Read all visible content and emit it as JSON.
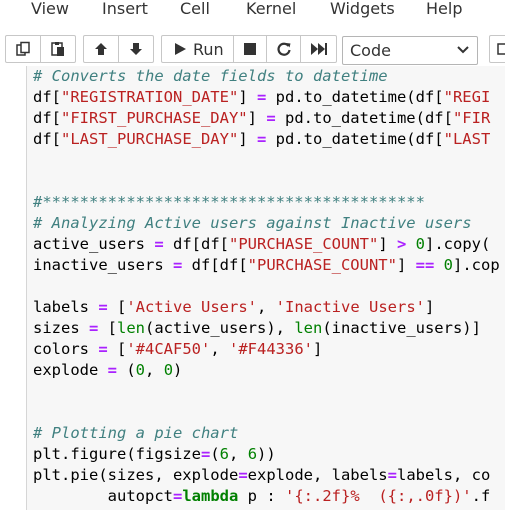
{
  "menu": {
    "items": [
      "View",
      "Insert",
      "Cell",
      "Kernel",
      "Widgets",
      "Help"
    ]
  },
  "toolbar": {
    "run_label": "Run",
    "cell_type": "Code",
    "buttons": [
      "copy-icon",
      "paste-icon",
      "move-up-icon",
      "move-down-icon",
      "run-icon",
      "stop-icon",
      "restart-icon",
      "fast-forward-icon",
      "command-palette-icon"
    ]
  },
  "colors": {
    "comment": "#408080",
    "string": "#BA2121",
    "operator": "#AA22FF",
    "keyword": "#008000",
    "number": "#008000"
  },
  "code": {
    "lines": [
      [
        [
          "cm",
          "# Converts the date fields to datetime"
        ]
      ],
      [
        [
          "t",
          "df["
        ],
        [
          "st",
          "\"REGISTRATION_DATE\""
        ],
        [
          "t",
          "] "
        ],
        [
          "op",
          "="
        ],
        [
          "t",
          " pd.to_datetime(df["
        ],
        [
          "st",
          "\"REGI"
        ]
      ],
      [
        [
          "t",
          "df["
        ],
        [
          "st",
          "\"FIRST_PURCHASE_DAY\""
        ],
        [
          "t",
          "] "
        ],
        [
          "op",
          "="
        ],
        [
          "t",
          " pd.to_datetime(df["
        ],
        [
          "st",
          "\"FIR"
        ]
      ],
      [
        [
          "t",
          "df["
        ],
        [
          "st",
          "\"LAST_PURCHASE_DAY\""
        ],
        [
          "t",
          "] "
        ],
        [
          "op",
          "="
        ],
        [
          "t",
          " pd.to_datetime(df["
        ],
        [
          "st",
          "\"LAST"
        ]
      ],
      [],
      [],
      [
        [
          "cm",
          "#*****************************************"
        ]
      ],
      [
        [
          "cm",
          "# Analyzing Active users against Inactive users"
        ]
      ],
      [
        [
          "t",
          "active_users "
        ],
        [
          "op",
          "="
        ],
        [
          "t",
          " df[df["
        ],
        [
          "st",
          "\"PURCHASE_COUNT\""
        ],
        [
          "t",
          "] "
        ],
        [
          "op",
          ">"
        ],
        [
          "t",
          " "
        ],
        [
          "nm",
          "0"
        ],
        [
          "t",
          "].copy("
        ]
      ],
      [
        [
          "t",
          "inactive_users "
        ],
        [
          "op",
          "="
        ],
        [
          "t",
          " df[df["
        ],
        [
          "st",
          "\"PURCHASE_COUNT\""
        ],
        [
          "t",
          "] "
        ],
        [
          "op",
          "=="
        ],
        [
          "t",
          " "
        ],
        [
          "nm",
          "0"
        ],
        [
          "t",
          "].cop"
        ]
      ],
      [],
      [
        [
          "t",
          "labels "
        ],
        [
          "op",
          "="
        ],
        [
          "t",
          " ["
        ],
        [
          "st",
          "'Active Users'"
        ],
        [
          "t",
          ", "
        ],
        [
          "st",
          "'Inactive Users'"
        ],
        [
          "t",
          "]"
        ]
      ],
      [
        [
          "t",
          "sizes "
        ],
        [
          "op",
          "="
        ],
        [
          "t",
          " ["
        ],
        [
          "bi",
          "len"
        ],
        [
          "t",
          "(active_users), "
        ],
        [
          "bi",
          "len"
        ],
        [
          "t",
          "(inactive_users)]"
        ]
      ],
      [
        [
          "t",
          "colors "
        ],
        [
          "op",
          "="
        ],
        [
          "t",
          " ["
        ],
        [
          "st",
          "'#4CAF50'"
        ],
        [
          "t",
          ", "
        ],
        [
          "st",
          "'#F44336'"
        ],
        [
          "t",
          "]"
        ]
      ],
      [
        [
          "t",
          "explode "
        ],
        [
          "op",
          "="
        ],
        [
          "t",
          " ("
        ],
        [
          "nm",
          "0"
        ],
        [
          "t",
          ", "
        ],
        [
          "nm",
          "0"
        ],
        [
          "t",
          ")"
        ]
      ],
      [],
      [],
      [
        [
          "cm",
          "# Plotting a pie chart"
        ]
      ],
      [
        [
          "t",
          "plt.figure(figsize"
        ],
        [
          "op",
          "="
        ],
        [
          "t",
          "("
        ],
        [
          "nm",
          "6"
        ],
        [
          "t",
          ", "
        ],
        [
          "nm",
          "6"
        ],
        [
          "t",
          "))"
        ]
      ],
      [
        [
          "t",
          "plt.pie(sizes, explode"
        ],
        [
          "op",
          "="
        ],
        [
          "t",
          "explode, labels"
        ],
        [
          "op",
          "="
        ],
        [
          "t",
          "labels, co"
        ]
      ],
      [
        [
          "t",
          "        autopct"
        ],
        [
          "op",
          "="
        ],
        [
          "kw",
          "lambda"
        ],
        [
          "t",
          " p : "
        ],
        [
          "st",
          "'{:.2f}%  ({:,.0f})'"
        ],
        [
          "t",
          ".f"
        ]
      ]
    ]
  }
}
